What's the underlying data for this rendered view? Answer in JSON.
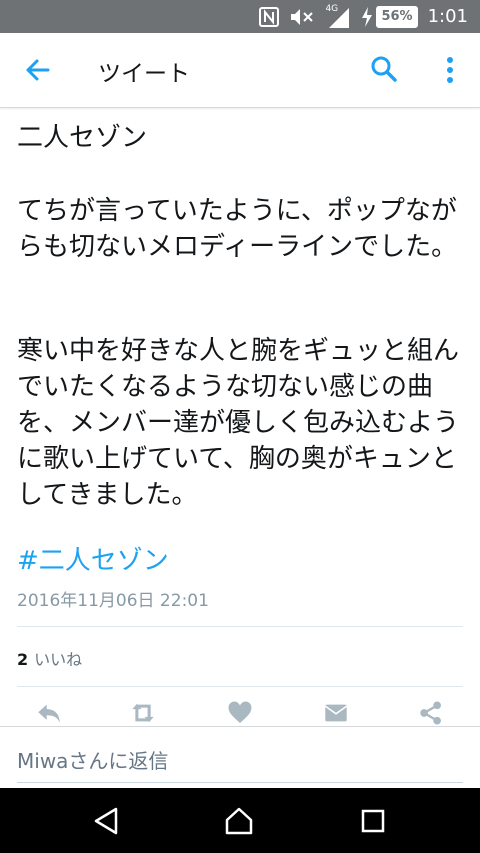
{
  "status_bar": {
    "network": "4G",
    "battery": "56%",
    "time": "1:01"
  },
  "app_bar": {
    "title": "ツイート"
  },
  "tweet": {
    "title": "二人セゾン",
    "para1": "てちが言っていたように、ポップながらも切ないメロディーラインでした。",
    "para2": "寒い中を好きな人と腕をギュッと組んでいたくなるような切ない感じの曲を、メンバー達が優しく包み込むように歌い上げていて、胸の奥がキュンとしてきました。",
    "hashtag": "#二人セゾン",
    "timestamp": "2016年11月06日 22:01",
    "likes_count": "2",
    "likes_label": "いいね"
  },
  "actions": [
    "reply-icon",
    "retweet-icon",
    "heart-icon",
    "mail-icon",
    "share-icon"
  ],
  "reply": {
    "placeholder": "Miwaさんに返信"
  },
  "colors": {
    "accent": "#1da1f2",
    "status_bar": "#6e7275",
    "icon_gray": "#aab8c2"
  }
}
